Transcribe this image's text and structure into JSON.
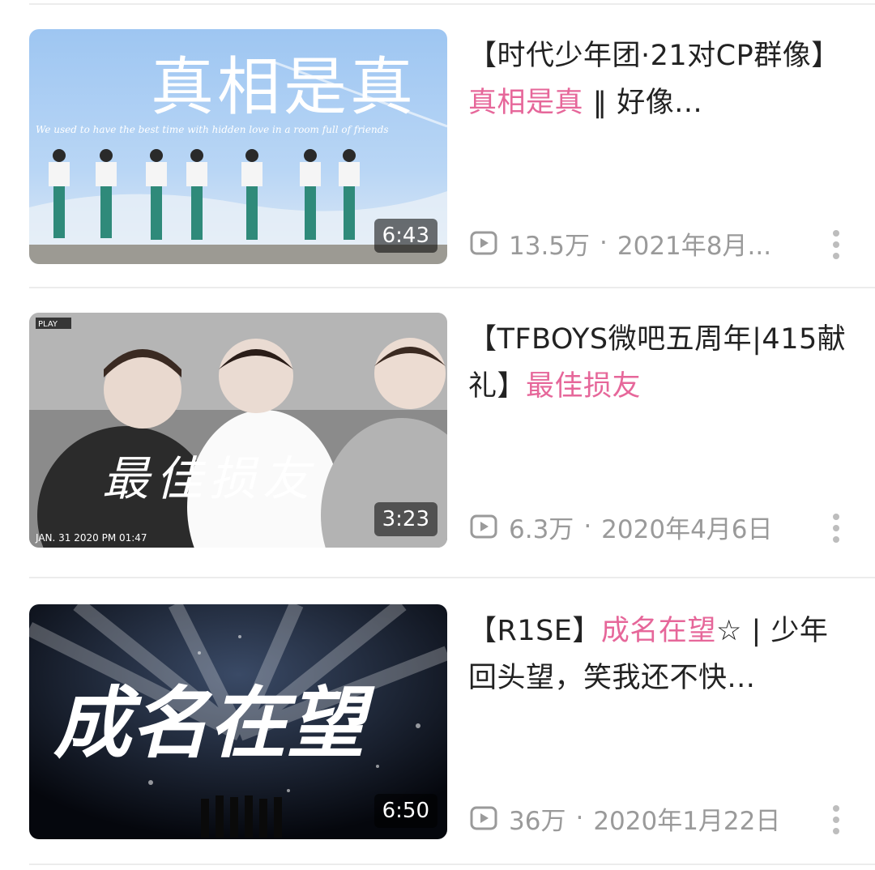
{
  "videos": [
    {
      "title_parts": [
        "【时代少年团·21对CP群像】",
        "真相是真",
        " ‖ 好像..."
      ],
      "thumb_text": "真相是真",
      "thumb_subtitle": "We used to have the best time with hidden love in a room full of friends",
      "duration": "6:43",
      "views": "13.5万",
      "date": "2021年8月..."
    },
    {
      "title_parts": [
        "【TFBOYS微吧五周年|415献礼】",
        "最佳损友",
        ""
      ],
      "thumb_text": "最佳损友",
      "thumb_tag": "PLAY",
      "thumb_stamp": "JAN. 31 2020 PM 01:47",
      "duration": "3:23",
      "views": "6.3万",
      "date": "2020年4月6日"
    },
    {
      "title_parts": [
        "【R1SE】",
        "成名在望",
        "☆ | 少年回头望，笑我还不快..."
      ],
      "thumb_text": "成名在望",
      "duration": "6:50",
      "views": "36万",
      "date": "2020年1月22日"
    }
  ],
  "meta_separator": "·",
  "colors": {
    "highlight": "#e6679a",
    "meta": "#9a9a9a",
    "title": "#222222"
  },
  "icons": {
    "views": "play-icon",
    "menu": "more-vertical-icon"
  }
}
